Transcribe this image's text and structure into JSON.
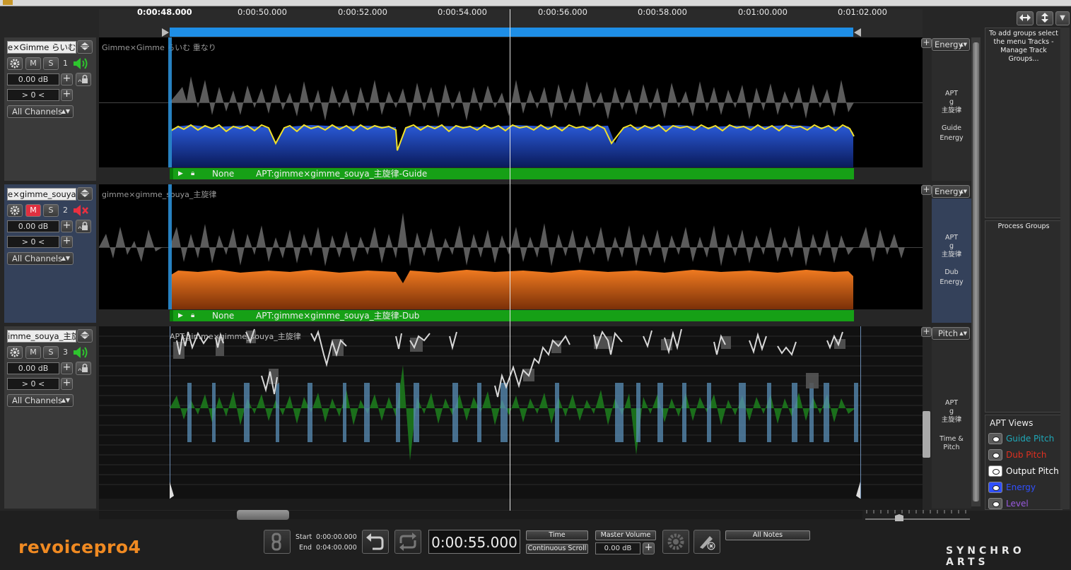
{
  "ruler": {
    "ticks": [
      "0:00:48.000",
      "0:00:50.000",
      "0:00:52.000",
      "0:00:54.000",
      "0:00:56.000",
      "0:00:58.000",
      "0:01:00.000",
      "0:01:02.000"
    ]
  },
  "tracks": [
    {
      "name": "e×Gimme  らいむ",
      "lane_label": "Gimme×Gimme  らいむ   重なり",
      "mute": "M",
      "solo": "S",
      "number": "1",
      "gain": "0.00 dB",
      "offset": "> 0 <",
      "channels": "All Channels",
      "bar_none": "None",
      "bar_label": "APT:gimme×gimme_souya_主旋律-Guide",
      "view": "Energy",
      "panel": [
        "APT",
        "g",
        "主旋律",
        "",
        "Guide",
        "Energy"
      ]
    },
    {
      "name": "e×gimme_souya_主",
      "lane_label": "gimme×gimme_souya_主旋律",
      "mute": "M",
      "solo": "S",
      "number": "2",
      "gain": "0.00 dB",
      "offset": "> 0 <",
      "channels": "All Channels",
      "bar_none": "None",
      "bar_label": "APT:gimme×gimme_souya_主旋律-Dub",
      "view": "Energy",
      "panel": [
        "APT",
        "g",
        "主旋律",
        "",
        "Dub",
        "Energy"
      ]
    },
    {
      "name": "imme_souya_主旋",
      "lane_label": "APT:gimme×gimme_souya_主旋律",
      "mute": "M",
      "solo": "S",
      "number": "3",
      "gain": "0.00 dB",
      "offset": "> 0 <",
      "channels": "All Channels",
      "view": "Pitch",
      "panel": [
        "APT",
        "g",
        "主旋律",
        "",
        "Time &",
        "Pitch"
      ]
    }
  ],
  "sidebar": {
    "groups_hint": "To add groups select the menu Tracks - Manage Track Groups...",
    "process_groups": "Process Groups",
    "apt_views_title": "APT Views",
    "views": [
      {
        "label": "Guide Pitch",
        "color": "#1fa8b8"
      },
      {
        "label": "Dub Pitch",
        "color": "#e03020"
      },
      {
        "label": "Output Pitch",
        "color": "#ffffff"
      },
      {
        "label": "Energy",
        "color": "#3050ff"
      },
      {
        "label": "Level",
        "color": "#9a5adf"
      }
    ]
  },
  "transport": {
    "start_label": "Start",
    "start_value": "0:00:00.000",
    "end_label": "End",
    "end_value": "0:04:00.000",
    "time": "0:00:55.000",
    "time_mode": "Time",
    "scroll_mode": "Continuous Scroll",
    "master_volume": "Master Volume",
    "master_value": "0.00 dB",
    "notes": "All Notes"
  },
  "brand": {
    "logo": "revoicepro",
    "logo_num": "4",
    "company": "SYNCHRO ARTS"
  }
}
